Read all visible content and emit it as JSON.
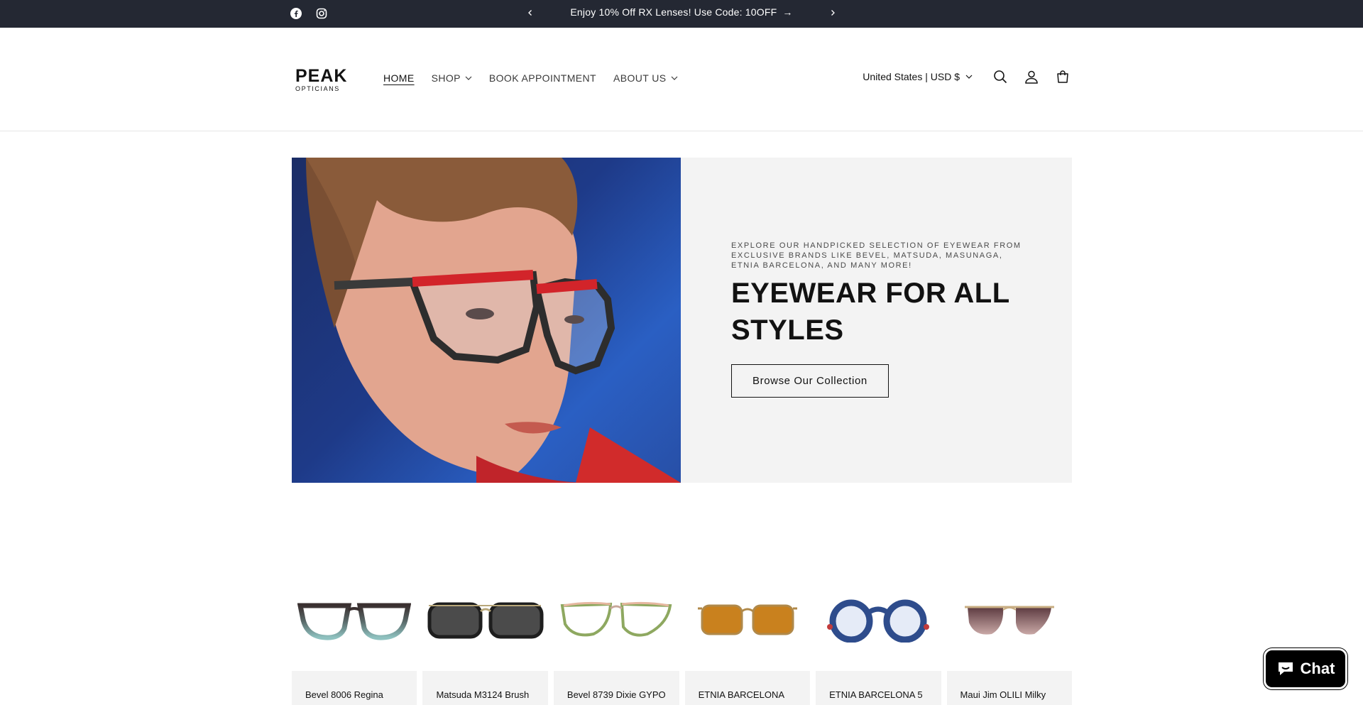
{
  "announcement": {
    "text": "Enjoy 10% Off RX Lenses! Use Code: 10OFF",
    "arrow": "→"
  },
  "logo": {
    "top": "PEAK",
    "sub": "OPTICIANS"
  },
  "nav": {
    "items": [
      {
        "label": "HOME"
      },
      {
        "label": "SHOP"
      },
      {
        "label": "BOOK APPOINTMENT"
      },
      {
        "label": "ABOUT US"
      }
    ]
  },
  "header": {
    "locale": "United States | USD $"
  },
  "hero": {
    "eyebrow": "EXPLORE OUR HANDPICKED SELECTION OF EYEWEAR FROM EXCLUSIVE BRANDS LIKE BEVEL, MATSUDA, MASUNAGA, ETNIA BARCELONA, AND MANY MORE!",
    "headline": "EYEWEAR FOR ALL STYLES",
    "cta": "Browse Our Collection"
  },
  "products": [
    {
      "title": "Bevel 8006 Regina"
    },
    {
      "title": "Matsuda M3124 Brush"
    },
    {
      "title": "Bevel 8739 Dixie GYPO"
    },
    {
      "title": "ETNIA BARCELONA"
    },
    {
      "title": "ETNIA BARCELONA 5"
    },
    {
      "title": "Maui Jim OLILI Milky"
    }
  ],
  "chat": {
    "label": "Chat"
  },
  "colors": {
    "announce_bg": "#242833",
    "hero_bg": "#f3f3f3",
    "chat_bg": "#000000"
  }
}
